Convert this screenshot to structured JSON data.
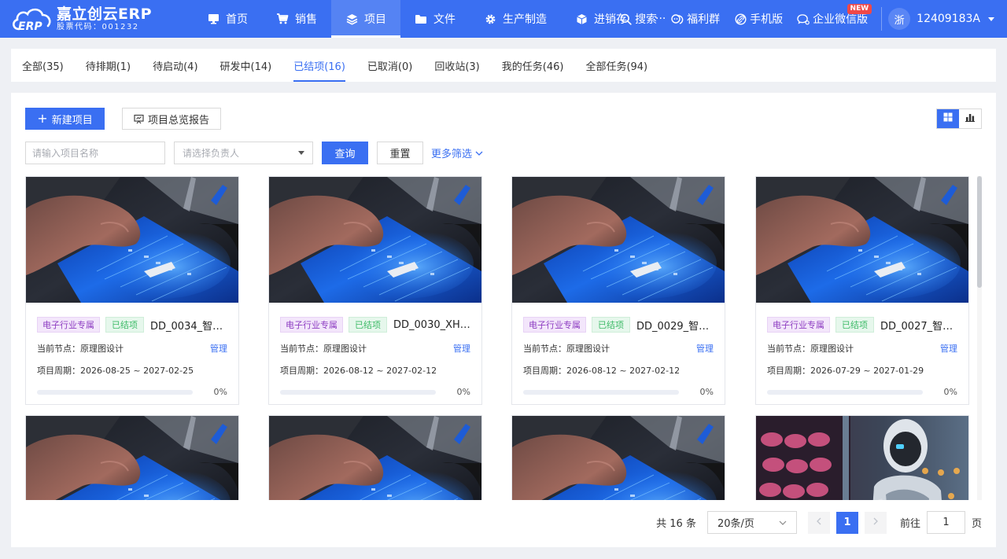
{
  "brand": {
    "title": "嘉立创云ERP",
    "subtitle": "股票代码：001232",
    "logo_text": "ERP"
  },
  "nav": {
    "items": [
      {
        "label": "首页",
        "icon": "monitor-icon"
      },
      {
        "label": "销售",
        "icon": "cart-icon"
      },
      {
        "label": "项目",
        "icon": "layers-icon",
        "active": true
      },
      {
        "label": "文件",
        "icon": "folder-icon"
      },
      {
        "label": "生产制造",
        "icon": "gear-icon"
      },
      {
        "label": "进销存",
        "icon": "box-icon"
      }
    ],
    "more": "···",
    "right": [
      {
        "label": "搜索",
        "icon": "search-icon"
      },
      {
        "label": "福利群",
        "icon": "chat-group-icon"
      },
      {
        "label": "手机版",
        "icon": "link-icon"
      },
      {
        "label": "企业微信版",
        "icon": "wecom-icon",
        "badge": "NEW"
      }
    ],
    "user": {
      "avatar": "浙",
      "name": "12409183A"
    }
  },
  "tabs": [
    {
      "label": "全部(35)"
    },
    {
      "label": "待排期(1)"
    },
    {
      "label": "待启动(4)"
    },
    {
      "label": "研发中(14)"
    },
    {
      "label": "已结项(16)",
      "active": true
    },
    {
      "label": "已取消(0)"
    },
    {
      "label": "回收站(3)"
    },
    {
      "label": "我的任务(46)"
    },
    {
      "label": "全部任务(94)"
    }
  ],
  "toolbar": {
    "new_label": "新建项目",
    "report_label": "项目总览报告"
  },
  "filters": {
    "name_placeholder": "请输入项目名称",
    "owner_placeholder": "请选择负责人",
    "query_label": "查询",
    "reset_label": "重置",
    "more_label": "更多筛选"
  },
  "colors": {
    "primary": "#3a6ff2",
    "tag_industry_bg": "#f3e6fb",
    "tag_status_bg": "#e6f7ec"
  },
  "projects": [
    {
      "industry": "电子行业专属",
      "status": "已结项",
      "name": "DD_0034_智能...",
      "node_label": "当前节点：",
      "node": "原理图设计",
      "manage": "管理",
      "period_label": "项目周期：",
      "period": "2026-08-25 ~ 2027-02-25",
      "progress": 0,
      "progress_text": "0%",
      "image": "circuit-board-photo"
    },
    {
      "industry": "电子行业专属",
      "status": "已结项",
      "name": "DD_0030_XHD...",
      "node_label": "当前节点：",
      "node": "原理图设计",
      "manage": "管理",
      "period_label": "项目周期：",
      "period": "2026-08-12 ~ 2027-02-12",
      "progress": 0,
      "progress_text": "0%",
      "image": "circuit-board-photo"
    },
    {
      "industry": "电子行业专属",
      "status": "已结项",
      "name": "DD_0029_智能...",
      "node_label": "当前节点：",
      "node": "原理图设计",
      "manage": "管理",
      "period_label": "项目周期：",
      "period": "2026-08-12 ~ 2027-02-12",
      "progress": 0,
      "progress_text": "0%",
      "image": "circuit-board-photo"
    },
    {
      "industry": "电子行业专属",
      "status": "已结项",
      "name": "DD_0027_智能...",
      "node_label": "当前节点：",
      "node": "原理图设计",
      "manage": "管理",
      "period_label": "项目周期：",
      "period": "2026-07-29 ~ 2027-01-29",
      "progress": 0,
      "progress_text": "0%",
      "image": "circuit-board-photo"
    }
  ],
  "projects_row2_images": [
    "circuit-board-photo",
    "circuit-board-photo",
    "circuit-board-photo",
    "robot-photo"
  ],
  "pager": {
    "total": "共 16 条",
    "page_size": "20条/页",
    "current": "1",
    "goto_label": "前往",
    "goto_value": "1",
    "goto_suffix": "页"
  }
}
